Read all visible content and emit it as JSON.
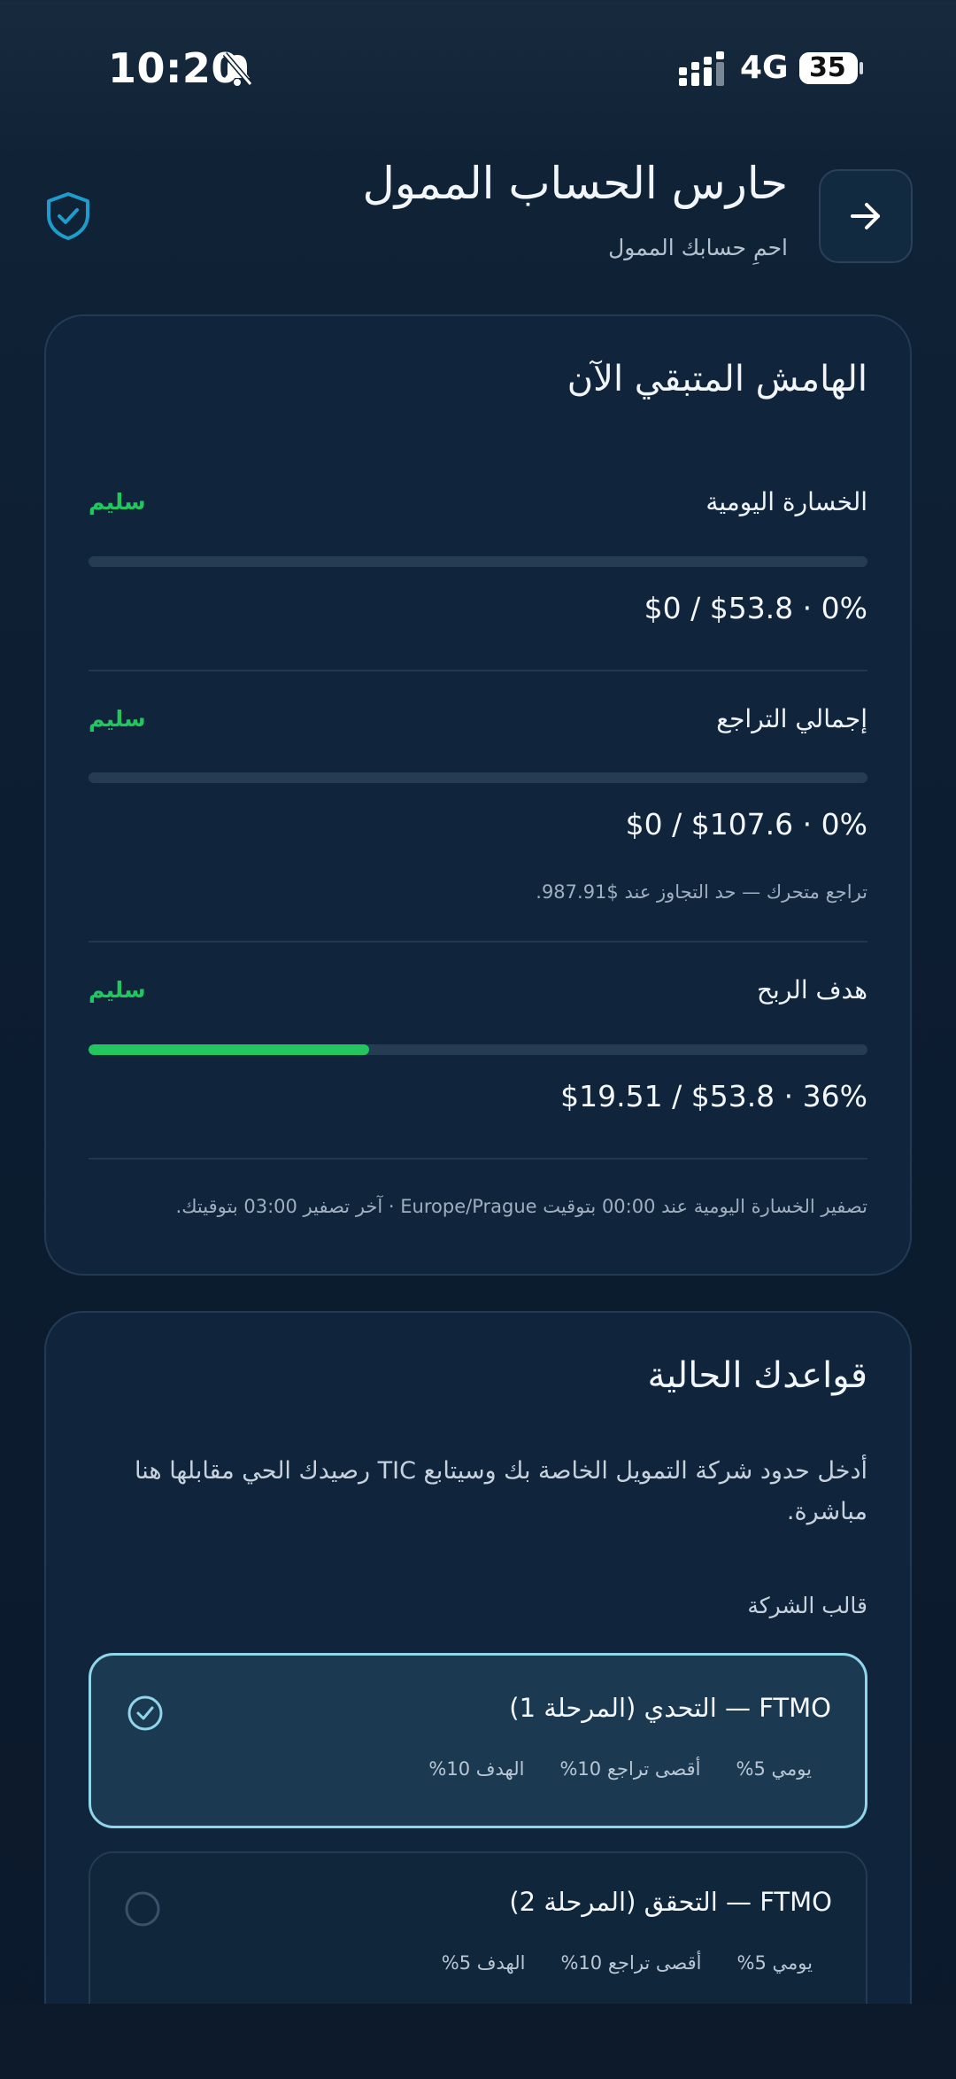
{
  "status_bar": {
    "time": "10:20",
    "network": "4G",
    "battery": "35"
  },
  "header": {
    "title": "حارس الحساب الممول",
    "subtitle": "احمِ حسابك الممول"
  },
  "margin_card": {
    "title": "الهامش المتبقي الآن",
    "metrics": [
      {
        "label": "الخسارة اليومية",
        "status": "سليم",
        "value": "$0 / $53.8 · 0%",
        "progress": 0
      },
      {
        "label": "إجمالي التراجع",
        "status": "سليم",
        "value": "$0 / $107.6 · 0%",
        "progress": 0,
        "note": "تراجع متحرك — حد التجاوز عند $987.91."
      },
      {
        "label": "هدف الربح",
        "status": "سليم",
        "value": "$19.51 / $53.8 · 36%",
        "progress": 0.36
      }
    ],
    "footer_note": "تصفير الخسارة اليومية عند 00:00 بتوقيت Europe/Prague · آخر تصفير 03:00 بتوقيتك."
  },
  "rules_card": {
    "title": "قواعدك الحالية",
    "description": "أدخل حدود شركة التمويل الخاصة بك وسيتابع TIC رصيدك الحي مقابلها هنا مباشرة.",
    "template_label": "قالب الشركة",
    "templates": [
      {
        "title": "FTMO — التحدي (المرحلة 1)",
        "daily": "يومي 5%",
        "max_dd": "أقصى تراجع 10%",
        "target": "الهدف 10%",
        "selected": true
      },
      {
        "title": "FTMO — التحقق (المرحلة 2)",
        "daily": "يومي 5%",
        "max_dd": "أقصى تراجع 10%",
        "target": "الهدف 5%",
        "selected": false
      }
    ]
  },
  "colors": {
    "safe": "#22c55e",
    "accent": "#8fd6ea",
    "shield": "#1e9ccc"
  }
}
